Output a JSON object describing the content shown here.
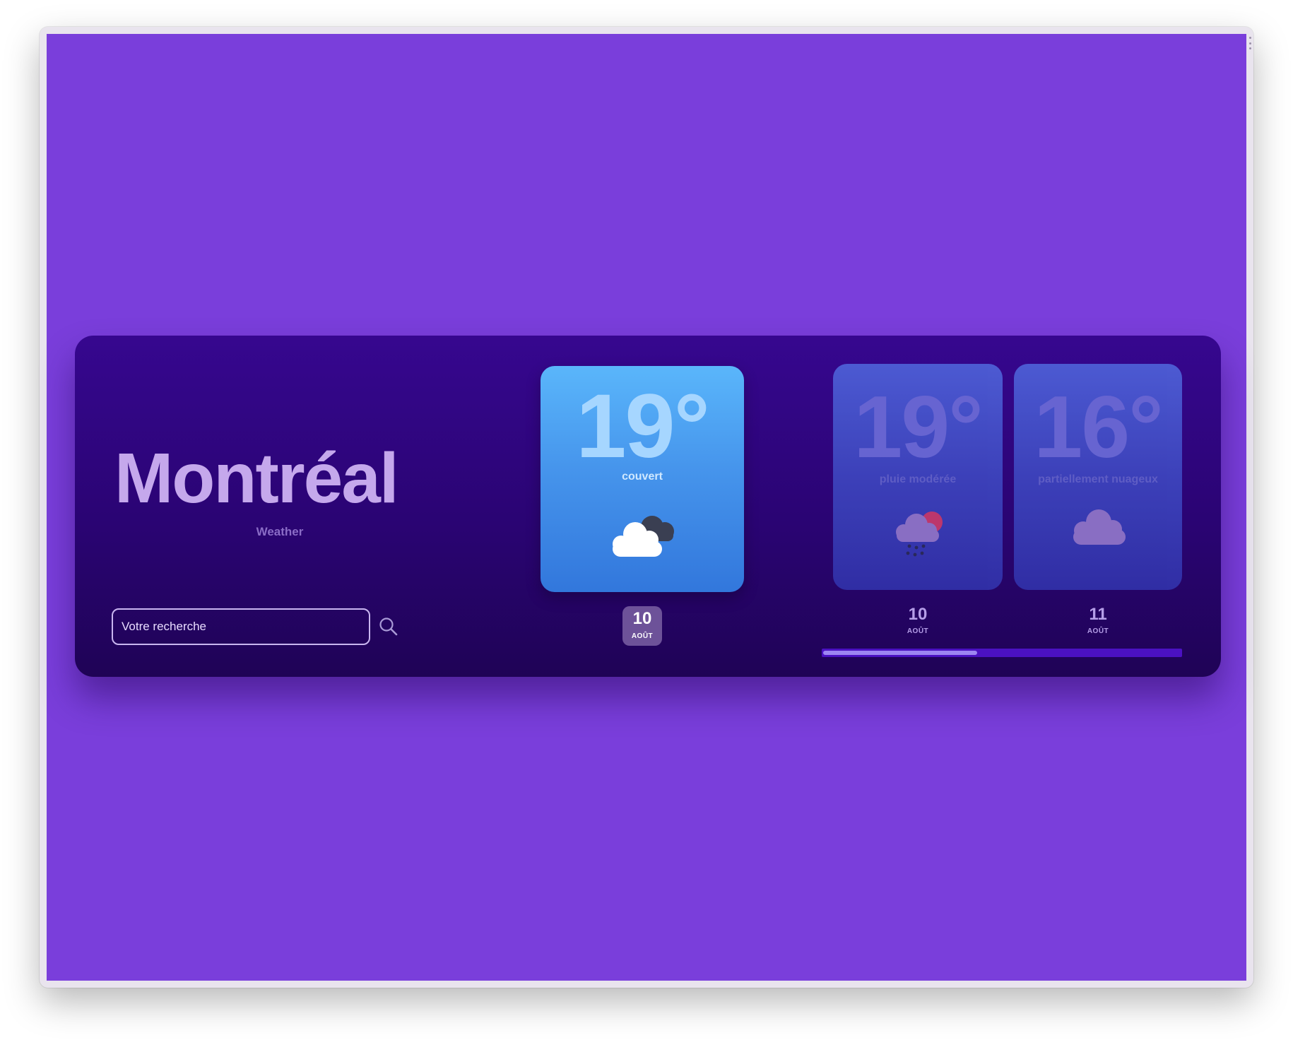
{
  "app": {
    "city": "Montréal",
    "subtitle": "Weather"
  },
  "search": {
    "placeholder": "Votre recherche",
    "icon": "search-icon"
  },
  "current": {
    "temperature": "19°",
    "condition": "couvert",
    "icon": "cloud-overcast-icon",
    "date_day": "10",
    "date_month": "AOÛT"
  },
  "forecast": [
    {
      "temperature": "19°",
      "condition": "pluie modérée",
      "icon": "cloud-rain-sun-icon",
      "date_day": "10",
      "date_month": "AOÛT"
    },
    {
      "temperature": "16°",
      "condition": "partiellement nuageux",
      "icon": "cloud-icon",
      "date_day": "11",
      "date_month": "AOÛT"
    }
  ],
  "scroll": {
    "position_fraction": 0.43
  },
  "colors": {
    "page_background": "#7a3edb",
    "card_background": "#2a0473",
    "accent_blue": "#4695ec",
    "scroll_track": "#4b11c2",
    "scroll_thumb": "#9d86f2"
  }
}
